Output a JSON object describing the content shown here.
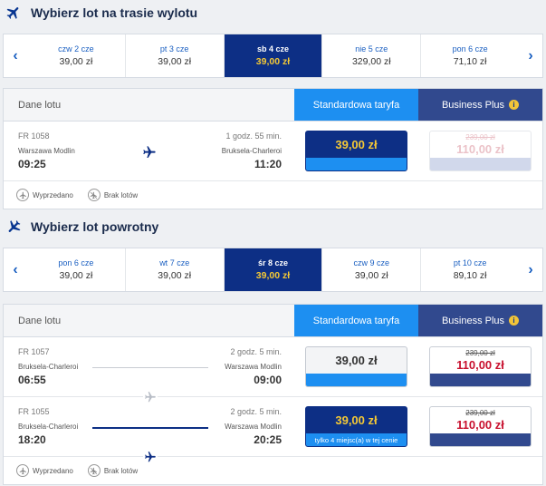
{
  "outbound": {
    "title": "Wybierz lot na trasie wylotu",
    "dates": [
      {
        "label": "czw 2 cze",
        "price": "39,00 zł"
      },
      {
        "label": "pt 3 cze",
        "price": "39,00 zł"
      },
      {
        "label": "sb 4 cze",
        "price": "39,00 zł",
        "selected": true
      },
      {
        "label": "nie 5 cze",
        "price": "329,00 zł"
      },
      {
        "label": "pon 6 cze",
        "price": "71,10 zł"
      }
    ],
    "header": {
      "details": "Dane lotu",
      "standard": "Standardowa taryfa",
      "business": "Business Plus"
    },
    "flights": [
      {
        "number": "FR 1058",
        "duration": "1 godz. 55 min.",
        "from": "Warszawa Modlin",
        "to": "Bruksela-Charleroi",
        "departure": "09:25",
        "arrival": "11:20",
        "standard_price": "39,00 zł",
        "business_old": "239,00 zł",
        "business_new": "110,00 zł"
      }
    ],
    "legend": {
      "sold_out": "Wyprzedano",
      "no_flights": "Brak lotów"
    }
  },
  "return": {
    "title": "Wybierz lot powrotny",
    "dates": [
      {
        "label": "pon 6 cze",
        "price": "39,00 zł"
      },
      {
        "label": "wt 7 cze",
        "price": "39,00 zł"
      },
      {
        "label": "śr 8 cze",
        "price": "39,00 zł",
        "selected": true
      },
      {
        "label": "czw 9 cze",
        "price": "39,00 zł"
      },
      {
        "label": "pt 10 cze",
        "price": "89,10 zł"
      }
    ],
    "header": {
      "details": "Dane lotu",
      "standard": "Standardowa taryfa",
      "business": "Business Plus"
    },
    "flights": [
      {
        "number": "FR 1057",
        "duration": "2 godz. 5 min.",
        "from": "Bruksela-Charleroi",
        "to": "Warszawa Modlin",
        "departure": "06:55",
        "arrival": "09:00",
        "standard_price": "39,00 zł",
        "business_old": "239,00 zł",
        "business_new": "110,00 zł"
      },
      {
        "number": "FR 1055",
        "duration": "2 godz. 5 min.",
        "from": "Bruksela-Charleroi",
        "to": "Warszawa Modlin",
        "departure": "18:20",
        "arrival": "20:25",
        "standard_price": "39,00 zł",
        "standard_note": "tylko 4 miejsc(a) w tej cenie",
        "business_old": "239,00 zł",
        "business_new": "110,00 zł"
      }
    ],
    "legend": {
      "sold_out": "Wyprzedano",
      "no_flights": "Brak lotów"
    }
  },
  "icons": {
    "plane": "plane-icon",
    "prev": "chevron-left-icon",
    "next": "chevron-right-icon",
    "info": "info-icon",
    "sold_out": "sold-out-icon",
    "no_flights": "no-flights-icon"
  },
  "colors": {
    "brand_dark": "#0d2f85",
    "standard_blue": "#1d8ff1",
    "business_blue": "#31498e",
    "price_yellow": "#f5c935",
    "price_red": "#c8102e"
  }
}
